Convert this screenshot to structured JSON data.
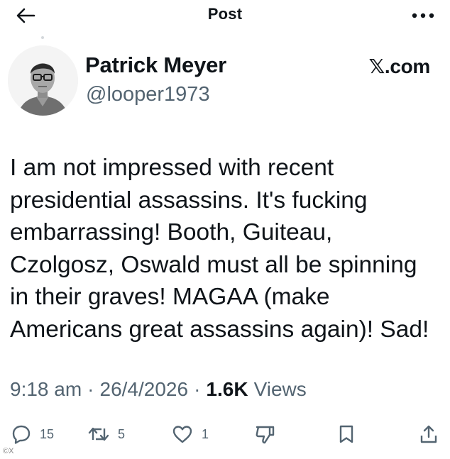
{
  "header": {
    "title": "Post",
    "back_icon": "arrow-left-icon",
    "more_icon": "more-horizontal-icon"
  },
  "author": {
    "name": "Patrick Meyer",
    "handle": "@looper1973",
    "avatar": "profile-photo"
  },
  "brand": "𝕏.com",
  "post": {
    "text": "I am not impressed with recent\npresidential assassins.  It's fucking\nembarrassing!  Booth, Guiteau,\nCzolgosz, Oswald must all be spinning\nin their graves!  MAGAA (make\nAmericans great assassins again)!  Sad!"
  },
  "meta": {
    "time": "9:18 am",
    "separator": "·",
    "date": "26/4/2026",
    "views_count": "1.6K",
    "views_label": "Views"
  },
  "actions": {
    "replies": "15",
    "reposts": "5",
    "likes": "1"
  },
  "watermark": "©X",
  "colors": {
    "text": "#0f1419",
    "secondary": "#536471",
    "background": "#ffffff"
  }
}
